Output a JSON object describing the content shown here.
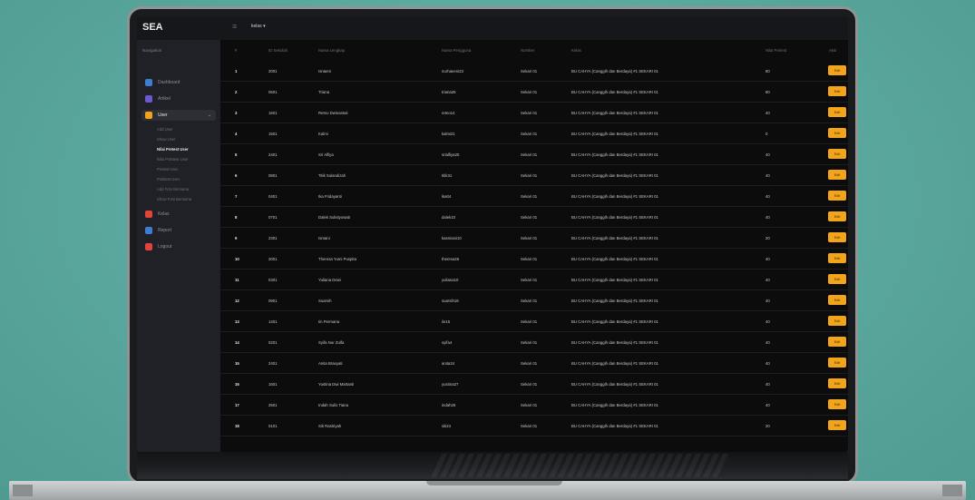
{
  "app": {
    "brand": "SEA",
    "user": "kelas"
  },
  "sidebar": {
    "heading": "Navigation",
    "items": [
      {
        "label": "Dashboard",
        "color": "#3c7fd1"
      },
      {
        "label": "Artikel",
        "color": "#6a5acd"
      },
      {
        "label": "User",
        "color": "#f2a51b"
      },
      {
        "label": "Kelas",
        "color": "#e0443a"
      },
      {
        "label": "Report",
        "color": "#3c7fd1"
      },
      {
        "label": "Logout",
        "color": "#e0443a"
      }
    ],
    "sub_items": [
      "Add User",
      "Show User",
      "Nilai Pretest User",
      "Nilai Posttest User",
      "Pretest User",
      "Posttest User",
      "Add Foto Bersama",
      "Show Foto Bersama"
    ]
  },
  "table": {
    "headers": [
      "#",
      "ID Sekolah",
      "Nama Lengkap",
      "Nama Pengguna",
      "Nomber",
      "Kelas",
      "Nilai Pretest",
      "Aksi"
    ],
    "edit_label": "Edit",
    "rows": [
      {
        "no": "1",
        "id": "2001",
        "nama": "Isnaeni",
        "username": "nurhaeeni23",
        "nomber": "Sekari 01",
        "kelas": "BU CAHYA (Canggih dan Berdaya) #1 SEKARI 01",
        "nilai": "80"
      },
      {
        "no": "2",
        "id": "0501",
        "nama": "Triana",
        "username": "triana26",
        "nomber": "Sekari 01",
        "kelas": "BU CAHYA (Canggih dan Berdaya) #1 SEKARI 01",
        "nilai": "80"
      },
      {
        "no": "3",
        "id": "1601",
        "nama": "Retno Dwinastuti",
        "username": "retno14",
        "nomber": "Sekari 01",
        "kelas": "BU CAHYA (Canggih dan Berdaya) #1 SEKARI 01",
        "nilai": "40"
      },
      {
        "no": "4",
        "id": "1501",
        "nama": "Kalmi",
        "username": "kalmi21",
        "nomber": "Sekari 01",
        "kelas": "BU CAHYA (Canggih dan Berdaya) #1 SEKARI 01",
        "nilai": "0"
      },
      {
        "no": "5",
        "id": "2401",
        "nama": "Sri Alfiya",
        "username": "srialfiya25",
        "nomber": "Sekari 01",
        "kelas": "BU CAHYA (Canggih dan Berdaya) #1 SEKARI 01",
        "nilai": "40"
      },
      {
        "no": "6",
        "id": "0801",
        "nama": "Titik Sulandizah",
        "username": "titik31",
        "nomber": "Sekari 01",
        "kelas": "BU CAHYA (Canggih dan Berdaya) #1 SEKARI 01",
        "nilai": "40"
      },
      {
        "no": "7",
        "id": "0401",
        "nama": "Ika Fridayanti",
        "username": "ika04",
        "nomber": "Sekari 01",
        "kelas": "BU CAHYA (Canggih dan Berdaya) #1 SEKARI 01",
        "nilai": "40"
      },
      {
        "no": "8",
        "id": "0701",
        "nama": "Dalek Sulistyowati",
        "username": "dalek10",
        "nomber": "Sekari 01",
        "kelas": "BU CAHYA (Canggih dan Berdaya) #1 SEKARI 01",
        "nilai": "40"
      },
      {
        "no": "9",
        "id": "2301",
        "nama": "Ismani",
        "username": "kasmiani10",
        "nomber": "Sekari 01",
        "kelas": "BU CAHYA (Canggih dan Berdaya) #1 SEKARI 01",
        "nilai": "20"
      },
      {
        "no": "10",
        "id": "2001",
        "nama": "Theresa Yumi Puspita",
        "username": "theresa26",
        "nomber": "Sekari 01",
        "kelas": "BU CAHYA (Canggih dan Berdaya) #1 SEKARI 01",
        "nilai": "40"
      },
      {
        "no": "11",
        "id": "0301",
        "nama": "Yuliana Dewi",
        "username": "yuliana10",
        "nomber": "Sekari 01",
        "kelas": "BU CAHYA (Canggih dan Berdaya) #1 SEKARI 01",
        "nilai": "40"
      },
      {
        "no": "12",
        "id": "0901",
        "nama": "Suarsih",
        "username": "suarsih18",
        "nomber": "Sekari 01",
        "kelas": "BU CAHYA (Canggih dan Berdaya) #1 SEKARI 01",
        "nilai": "40"
      },
      {
        "no": "13",
        "id": "1401",
        "nama": "Iin Permana",
        "username": "iin15",
        "nomber": "Sekari 01",
        "kelas": "BU CAHYA (Canggih dan Berdaya) #1 SEKARI 01",
        "nilai": "40"
      },
      {
        "no": "14",
        "id": "0201",
        "nama": "Syifa Nur Zulfa",
        "username": "syifa4",
        "nomber": "Sekari 01",
        "kelas": "BU CAHYA (Canggih dan Berdaya) #1 SEKARI 01",
        "nilai": "40"
      },
      {
        "no": "15",
        "id": "2401",
        "nama": "Anita Brasyati",
        "username": "anita24",
        "nomber": "Sekari 01",
        "kelas": "BU CAHYA (Canggih dan Berdaya) #1 SEKARI 01",
        "nilai": "40"
      },
      {
        "no": "16",
        "id": "1601",
        "nama": "Yustina Dwi Martanti",
        "username": "yustina27",
        "nomber": "Sekari 01",
        "kelas": "BU CAHYA (Canggih dan Berdaya) #1 SEKARI 01",
        "nilai": "40"
      },
      {
        "no": "17",
        "id": "2501",
        "nama": "Indah Sulis Tiana",
        "username": "indah26",
        "nomber": "Sekari 01",
        "kelas": "BU CAHYA (Canggih dan Berdaya) #1 SEKARI 01",
        "nilai": "40"
      },
      {
        "no": "18",
        "id": "0101",
        "nama": "Siti Rastriyah",
        "username": "siti24",
        "nomber": "Sekari 01",
        "kelas": "BU CAHYA (Canggih dan Berdaya) #1 SEKARI 01",
        "nilai": "20"
      }
    ]
  }
}
